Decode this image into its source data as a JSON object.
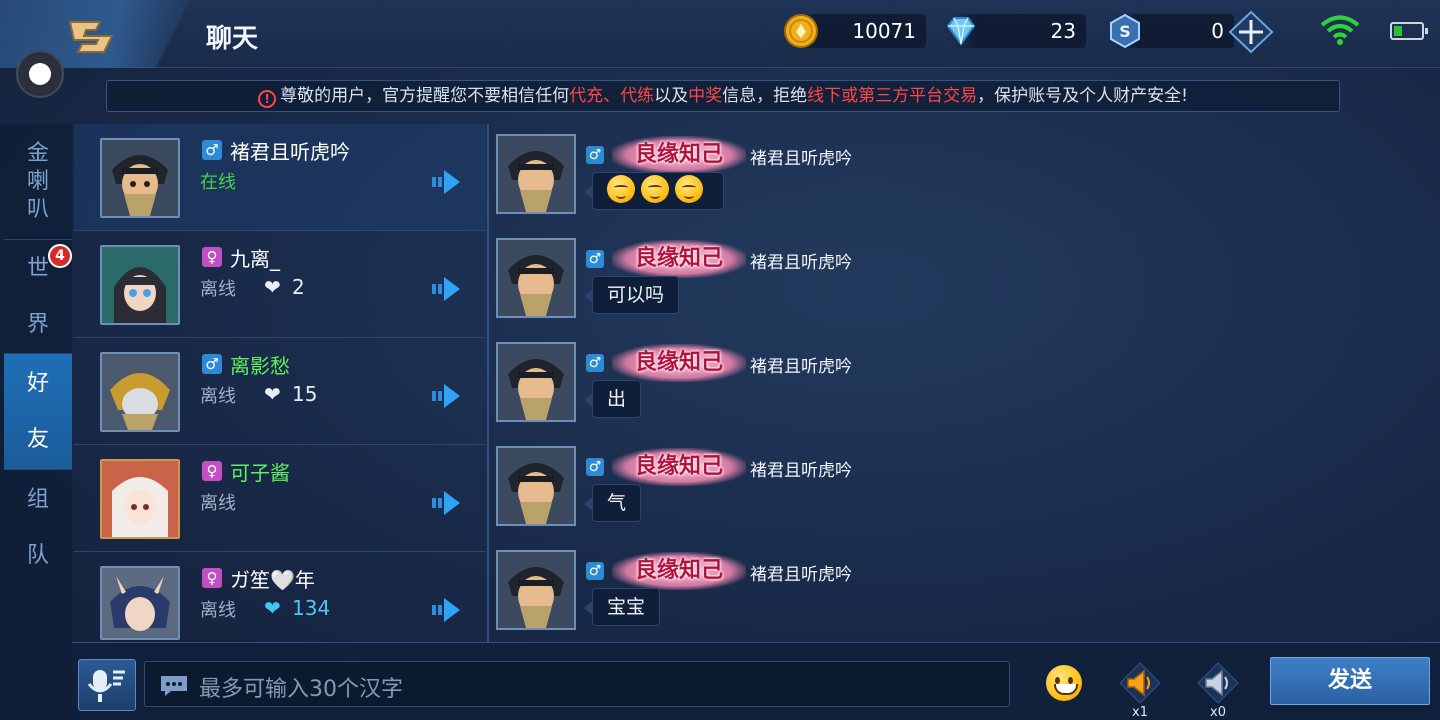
{
  "header": {
    "title": "聊天",
    "currencies": [
      {
        "icon": "gold-coin-icon",
        "value": "10071"
      },
      {
        "icon": "diamond-icon",
        "value": "23"
      },
      {
        "icon": "voucher-icon",
        "value": "0"
      }
    ]
  },
  "notice": {
    "parts": [
      "尊敬的用户，官方提醒您不要相信任何",
      "代充、代练",
      "以及",
      "中奖",
      "信息，拒绝",
      "线下或第三方平台交易",
      "，保护账号及个人财产安全!"
    ]
  },
  "tabs": [
    {
      "label": "金喇叭",
      "active": false
    },
    {
      "label": "世界",
      "badge": "4",
      "active": false
    },
    {
      "label": "好友",
      "active": true
    },
    {
      "label": "组队",
      "active": false
    }
  ],
  "friends": [
    {
      "name": "褚君且听虎吟",
      "gender": "♂",
      "status": "在线",
      "online": true,
      "likes": ""
    },
    {
      "name": "九离_",
      "gender": "♀",
      "status": "离线",
      "online": false,
      "likes": "2"
    },
    {
      "name": "离影愁",
      "gender": "♂",
      "status": "离线",
      "online": false,
      "likes": "15"
    },
    {
      "name": "可子酱",
      "gender": "♀",
      "status": "离线",
      "online": false,
      "likes": ""
    },
    {
      "name": "ガ笙🤍年",
      "gender": "♀",
      "status": "离线",
      "online": false,
      "likes": "134"
    }
  ],
  "messages": [
    {
      "badge": "良缘知己",
      "sender": "褚君且听虎吟",
      "text": "",
      "emojis": 3
    },
    {
      "badge": "良缘知己",
      "sender": "褚君且听虎吟",
      "text": "可以吗"
    },
    {
      "badge": "良缘知己",
      "sender": "褚君且听虎吟",
      "text": "出"
    },
    {
      "badge": "良缘知己",
      "sender": "褚君且听虎吟",
      "text": "气"
    },
    {
      "badge": "良缘知己",
      "sender": "褚君且听虎吟",
      "text": "宝宝"
    }
  ],
  "input": {
    "placeholder": "最多可输入30个汉字"
  },
  "speakers": [
    {
      "icon": "gold-speaker-icon",
      "count": "x1"
    },
    {
      "icon": "silver-speaker-icon",
      "count": "x0"
    }
  ],
  "send_label": "发送"
}
